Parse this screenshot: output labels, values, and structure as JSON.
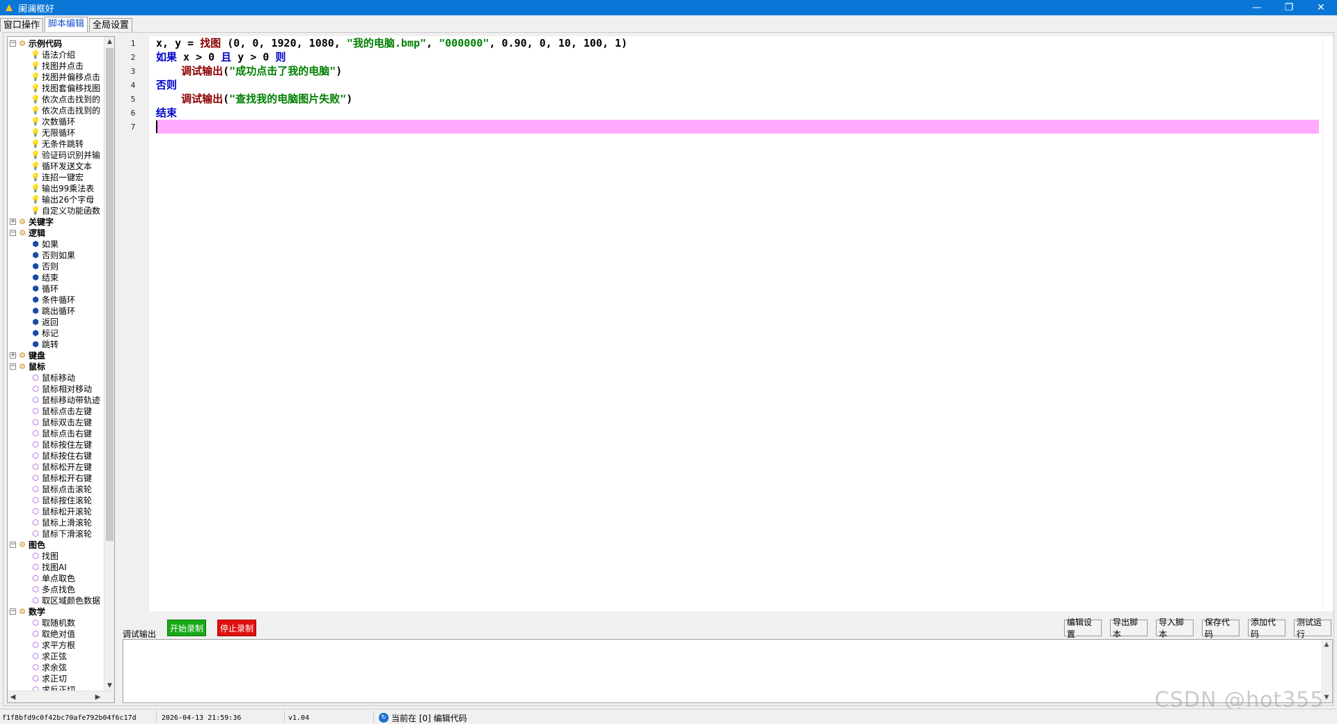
{
  "window": {
    "title": "阑澜框好",
    "controls": [
      "—",
      "❐",
      "✕"
    ]
  },
  "tabs": [
    {
      "label": "窗口操作",
      "active": false
    },
    {
      "label": "脚本编辑",
      "active": true
    },
    {
      "label": "全局设置",
      "active": false
    }
  ],
  "tree": {
    "groups": [
      {
        "label": "示例代码",
        "expanded": true,
        "icon": "bulb-icon",
        "items": [
          "语法介绍",
          "找图并点击",
          "找图并偏移点击",
          "找图套偏移找图",
          "依次点击找到的",
          "依次点击找到的",
          "次数循环",
          "无限循环",
          "无条件跳转",
          "验证码识别并输",
          "循环发送文本",
          "连招一键宏",
          "输出99乘法表",
          "输出26个字母",
          "自定义功能函数"
        ]
      },
      {
        "label": "关键字",
        "expanded": false,
        "icon": "cube-blue-icon",
        "items": []
      },
      {
        "label": "逻辑",
        "expanded": true,
        "icon": "cube-blue-icon",
        "items": [
          "如果",
          "否则如果",
          "否则",
          "结束",
          "循环",
          "条件循环",
          "跳出循环",
          "返回",
          "标记",
          "跳转"
        ]
      },
      {
        "label": "键盘",
        "expanded": false,
        "icon": "cube-purple-icon",
        "items": []
      },
      {
        "label": "鼠标",
        "expanded": true,
        "icon": "cube-purple-icon",
        "items": [
          "鼠标移动",
          "鼠标相对移动",
          "鼠标移动带轨迹",
          "鼠标点击左键",
          "鼠标双击左键",
          "鼠标点击右键",
          "鼠标按住左键",
          "鼠标按住右键",
          "鼠标松开左键",
          "鼠标松开右键",
          "鼠标点击滚轮",
          "鼠标按住滚轮",
          "鼠标松开滚轮",
          "鼠标上滑滚轮",
          "鼠标下滑滚轮"
        ]
      },
      {
        "label": "图色",
        "expanded": true,
        "icon": "cube-purple-icon",
        "items": [
          "找图",
          "找图AI",
          "单点取色",
          "多点找色",
          "取区域颜色数据"
        ]
      },
      {
        "label": "数学",
        "expanded": true,
        "icon": "cube-purple-icon",
        "items": [
          "取随机数",
          "取绝对值",
          "求平方根",
          "求正弦",
          "求余弦",
          "求正切",
          "求反正切"
        ]
      }
    ]
  },
  "editor": {
    "line_numbers": [
      "1",
      "2",
      "3",
      "4",
      "5",
      "6",
      "7"
    ],
    "lines": [
      [
        {
          "t": "x, y = ",
          "c": "plain"
        },
        {
          "t": "找图",
          "c": "fn"
        },
        {
          "t": " (0, 0, 1920, 1080, ",
          "c": "plain"
        },
        {
          "t": "\"我的电脑.bmp\"",
          "c": "str"
        },
        {
          "t": ", ",
          "c": "plain"
        },
        {
          "t": "\"000000\"",
          "c": "str"
        },
        {
          "t": ", 0.90, 0, 10, 100, 1)",
          "c": "plain"
        }
      ],
      [
        {
          "t": "如果",
          "c": "kw"
        },
        {
          "t": " x > 0 ",
          "c": "plain"
        },
        {
          "t": "且",
          "c": "kw"
        },
        {
          "t": " y > 0 ",
          "c": "plain"
        },
        {
          "t": "则",
          "c": "kw"
        }
      ],
      [
        {
          "t": "    ",
          "c": "plain"
        },
        {
          "t": "调试输出",
          "c": "fn"
        },
        {
          "t": "(",
          "c": "plain"
        },
        {
          "t": "\"成功点击了我的电脑\"",
          "c": "str"
        },
        {
          "t": ")",
          "c": "plain"
        }
      ],
      [
        {
          "t": "否则",
          "c": "kw"
        }
      ],
      [
        {
          "t": "    ",
          "c": "plain"
        },
        {
          "t": "调试输出",
          "c": "fn"
        },
        {
          "t": "(",
          "c": "plain"
        },
        {
          "t": "\"查找我的电脑图片失败\"",
          "c": "str"
        },
        {
          "t": ")",
          "c": "plain"
        }
      ],
      [
        {
          "t": "结束",
          "c": "kw"
        }
      ],
      []
    ],
    "current_line": 7
  },
  "bottom": {
    "debug_label": "调试输出",
    "start_record": "开始录制",
    "stop_record": "停止录制",
    "edit_settings": "编辑设置",
    "export_script": "导出脚本",
    "import_script": "导入脚本",
    "save_code": "保存代码",
    "add_code": "添加代码",
    "test_run": "测试运行",
    "output_text": ""
  },
  "status": {
    "hash": "f1f8bfd9c0f42bc70afe792b04f6c17d",
    "datetime": "2026-04-13 21:59:36",
    "version": "v1.04",
    "mode": "当前在 [0] 编辑代码"
  },
  "watermark": "CSDN @hot355",
  "colors": {
    "titlebar": "#0a76d6",
    "keyword": "#0000cc",
    "function": "#8b0000",
    "string": "#008000",
    "current_line": "#ffaaff",
    "start_btn": "#17a817",
    "stop_btn": "#e01010"
  }
}
